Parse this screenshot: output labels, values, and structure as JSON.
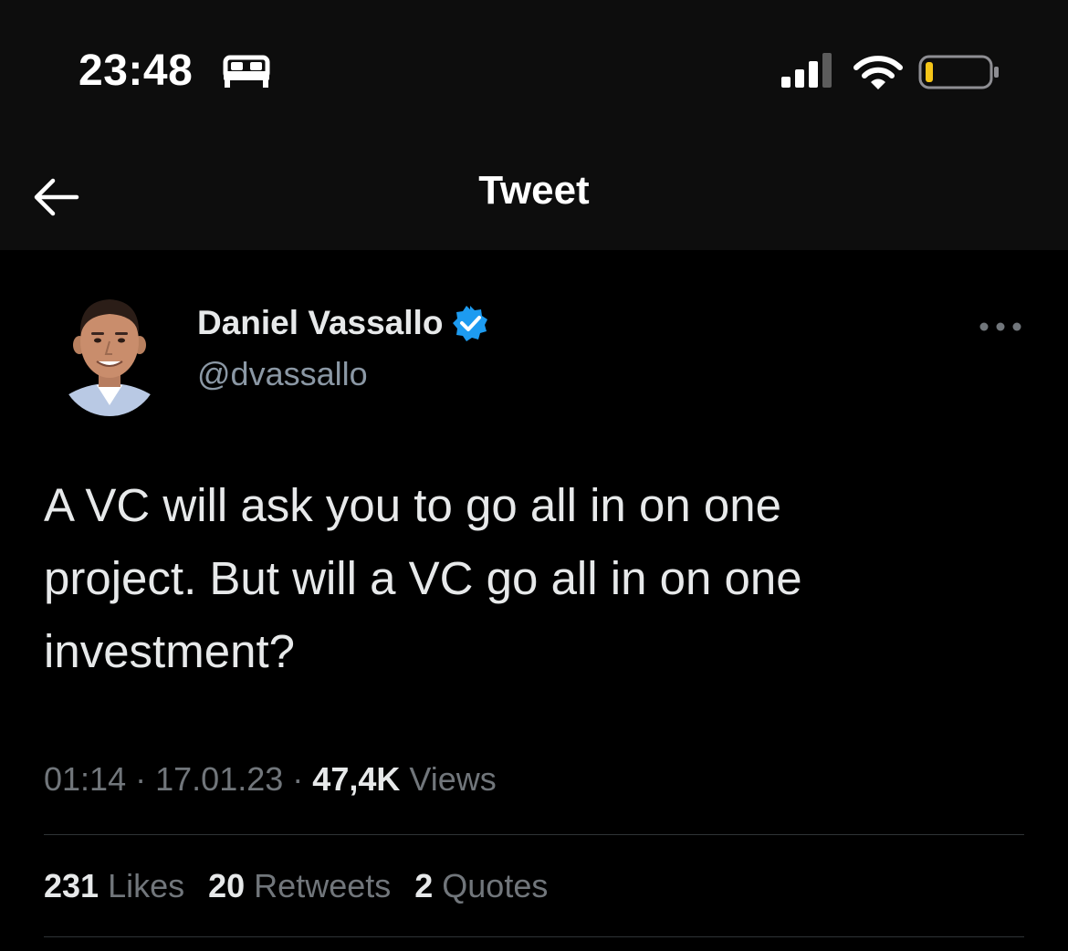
{
  "status_bar": {
    "time": "23:48",
    "icons": [
      "bed-icon",
      "cellular-signal-icon",
      "wifi-icon",
      "battery-low-icon"
    ],
    "battery_color": "#f5c518"
  },
  "header": {
    "back_icon": "arrow-left-icon",
    "title": "Tweet"
  },
  "tweet": {
    "author": {
      "name": "Daniel Vassallo",
      "handle": "@dvassallo",
      "verified": true,
      "verified_color": "#1d9bf0"
    },
    "more_icon": "more-horizontal-icon",
    "text": "A VC will ask you to go all in on one\nproject. But will a VC go all in on one\ninvestment?",
    "time": "01:14",
    "date": "17.01.23",
    "separator": "·",
    "views_count": "47,4K",
    "views_label": "Views"
  },
  "stats": [
    {
      "count": "231",
      "label": "Likes"
    },
    {
      "count": "20",
      "label": "Retweets"
    },
    {
      "count": "2",
      "label": "Quotes"
    }
  ],
  "colors": {
    "background": "#000000",
    "header_background": "#0d0d0d",
    "primary_text": "#e7e9ea",
    "secondary_text": "#71767b",
    "divider": "#2f3336"
  }
}
